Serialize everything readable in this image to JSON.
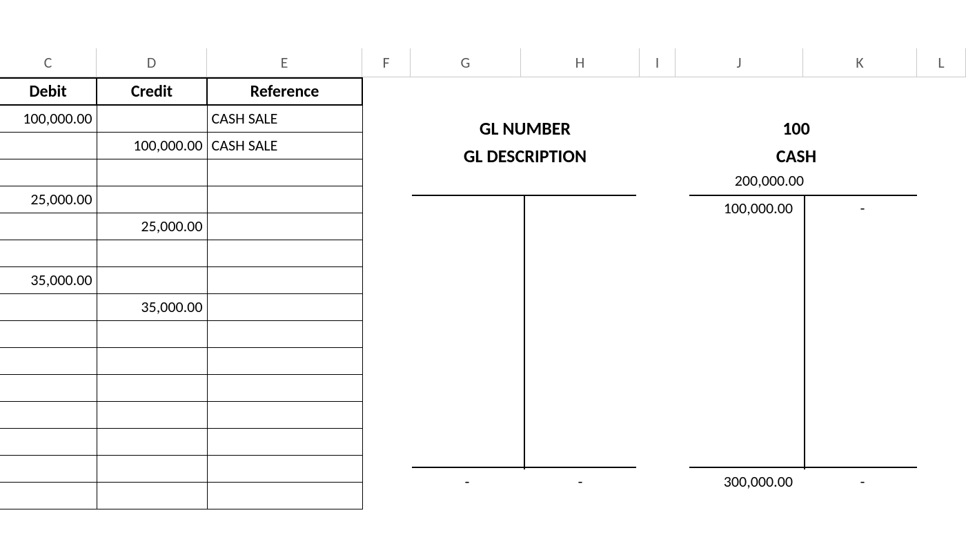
{
  "columns": [
    "C",
    "D",
    "E",
    "F",
    "G",
    "H",
    "I",
    "J",
    "K",
    "L"
  ],
  "ledger": {
    "headers": {
      "debit": "Debit",
      "credit": "Credit",
      "reference": "Reference"
    },
    "rows": [
      {
        "debit": "100,000.00",
        "credit": "",
        "reference": "CASH SALE"
      },
      {
        "debit": "",
        "credit": "100,000.00",
        "reference": "CASH SALE"
      },
      {
        "debit": "",
        "credit": "",
        "reference": ""
      },
      {
        "debit": "25,000.00",
        "credit": "",
        "reference": ""
      },
      {
        "debit": "",
        "credit": "25,000.00",
        "reference": ""
      },
      {
        "debit": "",
        "credit": "",
        "reference": ""
      },
      {
        "debit": "35,000.00",
        "credit": "",
        "reference": ""
      },
      {
        "debit": "",
        "credit": "35,000.00",
        "reference": ""
      },
      {
        "debit": "",
        "credit": "",
        "reference": ""
      },
      {
        "debit": "",
        "credit": "",
        "reference": ""
      },
      {
        "debit": "",
        "credit": "",
        "reference": ""
      },
      {
        "debit": "",
        "credit": "",
        "reference": ""
      },
      {
        "debit": "",
        "credit": "",
        "reference": ""
      },
      {
        "debit": "",
        "credit": "",
        "reference": ""
      },
      {
        "debit": "",
        "credit": "",
        "reference": ""
      }
    ]
  },
  "gl": {
    "label_number": "GL NUMBER",
    "label_description": "GL DESCRIPTION",
    "number": "100",
    "description": "CASH",
    "balance": "200,000.00"
  },
  "t_left": {
    "sum_left": "-",
    "sum_right": "-"
  },
  "t_right": {
    "debit_1": "100,000.00",
    "credit_1": "-",
    "sum_left": "300,000.00",
    "sum_right": "-"
  }
}
